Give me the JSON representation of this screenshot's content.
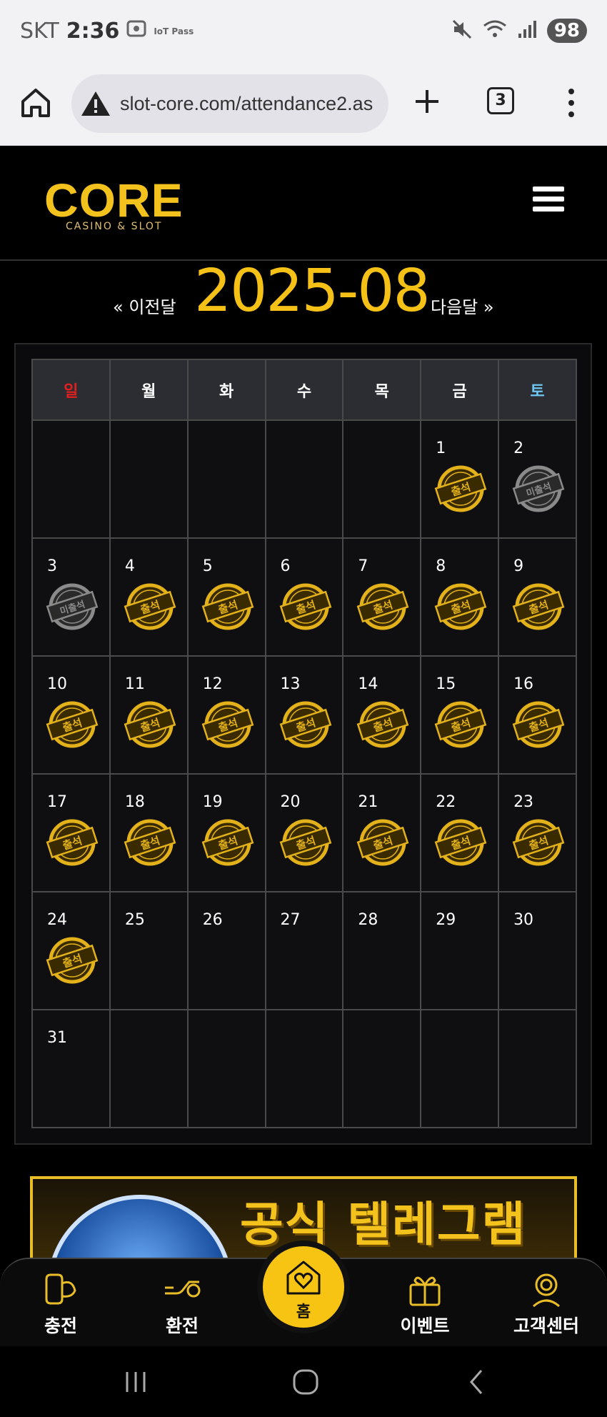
{
  "statusbar": {
    "carrier": "SKT",
    "time": "2:36",
    "iot_label": "IoT Pass",
    "battery": "98"
  },
  "browser": {
    "url": "slot-core.com/attendance2.as",
    "tab_count": "3"
  },
  "site": {
    "logo_text": "CORE",
    "logo_subtext": "CASINO & SLOT"
  },
  "month_nav": {
    "prev_label": "« 이전달",
    "next_label": "다음달 »",
    "title": "2025-08"
  },
  "calendar": {
    "weekdays": [
      "일",
      "월",
      "화",
      "수",
      "목",
      "금",
      "토"
    ],
    "weekday_colors": [
      "#e0201e",
      "#ffffff",
      "#ffffff",
      "#ffffff",
      "#ffffff",
      "#ffffff",
      "#6ec6f0"
    ],
    "stamp_attended_label": "출석",
    "stamp_absent_label": "미출석",
    "weeks": [
      [
        null,
        null,
        null,
        null,
        null,
        {
          "day": "1",
          "status": "attended"
        },
        {
          "day": "2",
          "status": "absent"
        }
      ],
      [
        {
          "day": "3",
          "status": "absent"
        },
        {
          "day": "4",
          "status": "attended"
        },
        {
          "day": "5",
          "status": "attended"
        },
        {
          "day": "6",
          "status": "attended"
        },
        {
          "day": "7",
          "status": "attended"
        },
        {
          "day": "8",
          "status": "attended"
        },
        {
          "day": "9",
          "status": "attended"
        }
      ],
      [
        {
          "day": "10",
          "status": "attended"
        },
        {
          "day": "11",
          "status": "attended"
        },
        {
          "day": "12",
          "status": "attended"
        },
        {
          "day": "13",
          "status": "attended"
        },
        {
          "day": "14",
          "status": "attended"
        },
        {
          "day": "15",
          "status": "attended"
        },
        {
          "day": "16",
          "status": "attended"
        }
      ],
      [
        {
          "day": "17",
          "status": "attended"
        },
        {
          "day": "18",
          "status": "attended"
        },
        {
          "day": "19",
          "status": "attended"
        },
        {
          "day": "20",
          "status": "attended"
        },
        {
          "day": "21",
          "status": "attended"
        },
        {
          "day": "22",
          "status": "attended"
        },
        {
          "day": "23",
          "status": "attended"
        }
      ],
      [
        {
          "day": "24",
          "status": "attended"
        },
        {
          "day": "25",
          "status": "none"
        },
        {
          "day": "26",
          "status": "none"
        },
        {
          "day": "27",
          "status": "none"
        },
        {
          "day": "28",
          "status": "none"
        },
        {
          "day": "29",
          "status": "none"
        },
        {
          "day": "30",
          "status": "none"
        }
      ],
      [
        {
          "day": "31",
          "status": "none"
        },
        null,
        null,
        null,
        null,
        null,
        null
      ]
    ]
  },
  "banner": {
    "text": "공식 텔레그램"
  },
  "bottom_nav": {
    "charge": "충전",
    "exchange": "환전",
    "home": "홈",
    "event": "이벤트",
    "support": "고객센터"
  },
  "colors": {
    "accent_gold": "#f5c116",
    "background": "#000000"
  }
}
